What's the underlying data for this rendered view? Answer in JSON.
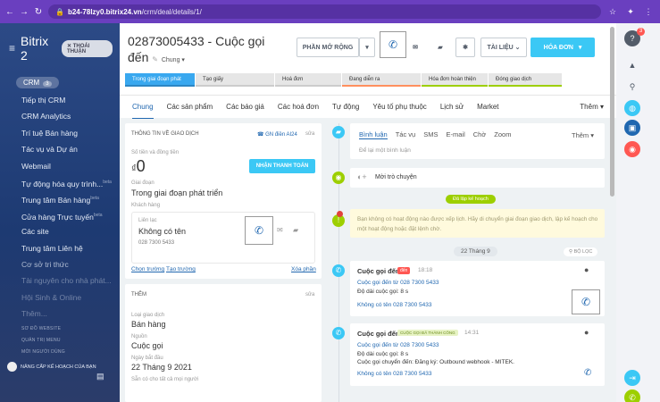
{
  "browser": {
    "url_host": "b24-78lzy0.bitrix24.vn",
    "url_path": "/crm/deal/details/1/"
  },
  "sidebar": {
    "logo": "Bitrix 2",
    "close": "THOÁI THUẬN",
    "crm": "CRM",
    "crm_badge": "3",
    "items": [
      "Tiếp thị CRM",
      "CRM Analytics",
      "Trí tuệ Bán hàng",
      "Tác vụ và Dự án",
      "Webmail",
      "Tự động hóa quy trình...",
      "Trung tâm Bán hàng",
      "Cửa hàng Trực tuyến",
      "Các site",
      "Trung tâm Liên hệ",
      "Cơ sở tri thức",
      "Tài nguyên cho nhà phát...",
      "Hội Sinh & Online",
      "Thêm..."
    ],
    "item_beta": "beta",
    "foot": [
      "SƠ ĐỒ WEBSITE",
      "QUẢN TRỊ MENU",
      "MỜI NGƯỜI DÙNG"
    ],
    "upgrade": "NÂNG CẤP KẾ HOẠCH CỦA BẠN"
  },
  "header": {
    "title_line1": "02873005433 - Cuộc gọi",
    "title_line2": "đến",
    "pipeline": "Chung",
    "btn_extend": "PHẦN MỞ RỘNG",
    "btn_docs": "TÀI LIỆU",
    "btn_invoice": "HÓA ĐƠN"
  },
  "stages": [
    "Trong giai đoạn phát triển",
    "Tạo giấy",
    "Hoá đơn",
    "Đang diễn ra",
    "Hóa đơn hoàn thiện",
    "Đóng giao dịch"
  ],
  "tabs": [
    "Chung",
    "Các sản phẩm",
    "Các báo giá",
    "Các hoá đơn",
    "Tự động",
    "Yêu tố phụ thuộc",
    "Lịch sử",
    "Market"
  ],
  "tabs_more": "Thêm",
  "info": {
    "section": "THÔNG TIN VỀ GIAO DỊCH",
    "edit": "GN điền AI24",
    "sua": "sửa",
    "amount_label": "Số tiền và đồng tiền",
    "currency": "₫",
    "amount": "0",
    "pay_btn": "NHẬN THANH TOÁN",
    "stage_label": "Giai đoạn",
    "stage": "Trong giai đoạn phát triển",
    "client_label": "Khách hàng",
    "contact_label": "Liên lạc",
    "contact": "Không có tên",
    "contact_phone": "028 7300 5433",
    "select_field": "Chọn trường",
    "create_field": "Tạo trường",
    "delete": "Xóa phần"
  },
  "more": {
    "section": "THÊM",
    "sua": "sửa",
    "type_label": "Loại giao dịch",
    "type": "Bán hàng",
    "source_label": "Nguồn",
    "source": "Cuộc gọi",
    "start_label": "Ngày bắt đầu",
    "start": "22 Tháng 9 2021",
    "avail_label": "Sẵn có cho tất cả mọi người"
  },
  "feed": {
    "tabs": [
      "Bình luận",
      "Tác vụ",
      "SMS",
      "E-mail",
      "Chờ",
      "Zoom"
    ],
    "more": "Thêm",
    "comment_ph": "Để lại một bình luận",
    "invite": "Mời trò chuyện",
    "planned": "Đã lập kế hoạch",
    "warning": "Bạn không có hoạt động nào được xếp lịch. Hãy di chuyển giai đoạn giao dịch, lập kế hoạch cho một hoạt động hoặc đặt lệnh chờ.",
    "date": "22 Tháng 9",
    "filter": "BỘ LỌC",
    "call1": {
      "title": "Cuộc gọi đến",
      "badge": "đến",
      "time": "18:18",
      "from": "Cuộc gọi đến từ 028 7300 5433",
      "dur": "Độ dài cuộc gọi: 8 s",
      "name": "Không có tên 028 7300 5433"
    },
    "call2": {
      "title": "Cuộc gọi đến",
      "badge": "CUỘC GỌI ĐÃ THÀNH CÔNG",
      "time": "14:31",
      "from": "Cuộc gọi đến từ 028 7300 5433",
      "dur": "Độ dài cuộc gọi: 8 s",
      "transfer": "Cuộc gọi chuyển đến: Đăng ký: Outbound webhook - MITEK.",
      "name": "Không có tên 028 7300 5433"
    }
  },
  "right_badge": "3",
  "colors": {
    "accent": "#3bc8f5",
    "link": "#2067b0",
    "stage": "#39a8ef"
  }
}
